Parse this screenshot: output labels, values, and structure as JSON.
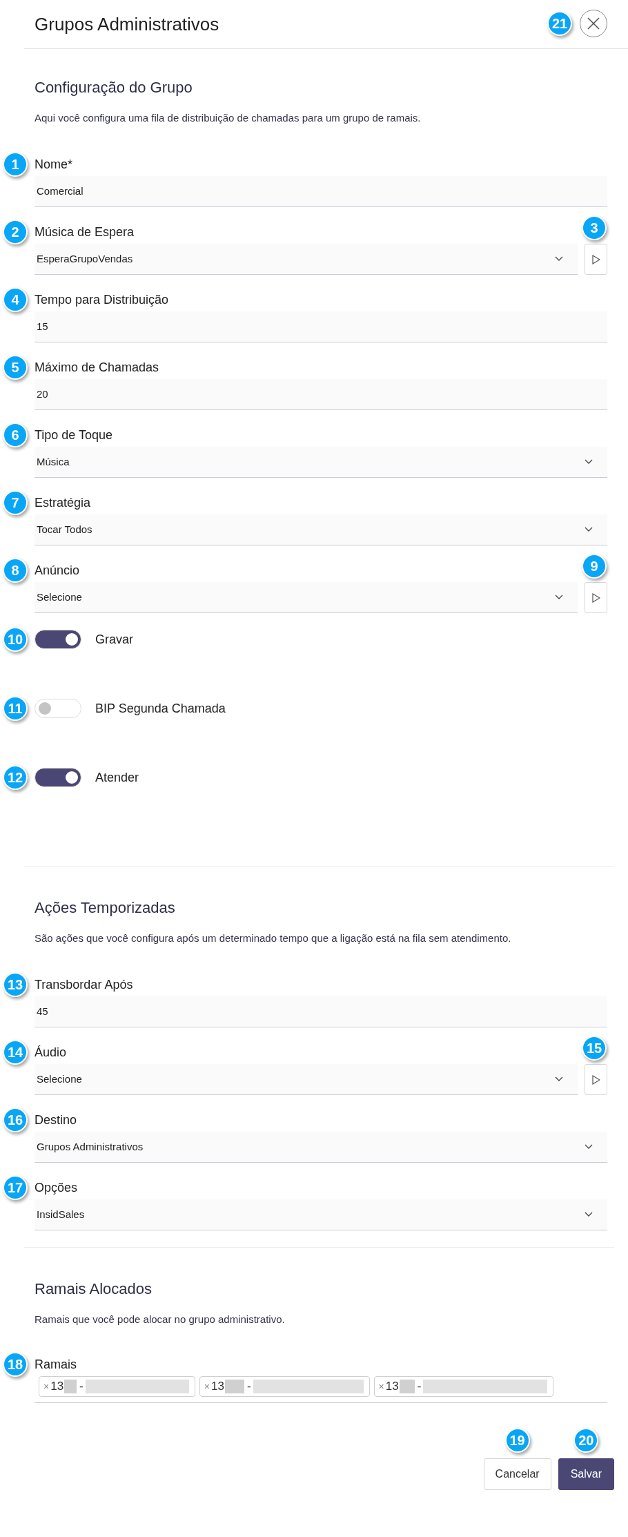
{
  "header": {
    "title": "Grupos Administrativos",
    "close_badge": "21"
  },
  "sections": [
    {
      "title": "Configuração do Grupo",
      "description": "Aqui você configura uma fila de distribuição de chamadas para um grupo de ramais.",
      "fields": [
        {
          "kind": "input",
          "badge": "1",
          "label": "Nome*",
          "value": "Comercial"
        },
        {
          "kind": "select",
          "badge": "2",
          "label": "Música de Espera",
          "value": "EsperaGrupoVendas",
          "play_badge": "3"
        },
        {
          "kind": "input",
          "badge": "4",
          "label": "Tempo para Distribuição",
          "value": "15"
        },
        {
          "kind": "input",
          "badge": "5",
          "label": "Máximo de Chamadas",
          "value": "20"
        },
        {
          "kind": "select",
          "badge": "6",
          "label": "Tipo de Toque",
          "value": "Música"
        },
        {
          "kind": "select",
          "badge": "7",
          "label": "Estratégia",
          "value": "Tocar Todos"
        },
        {
          "kind": "select",
          "badge": "8",
          "label": "Anúncio",
          "value": "Selecione",
          "play_badge": "9"
        },
        {
          "kind": "toggle",
          "badge": "10",
          "label": "Gravar",
          "on": true
        },
        {
          "kind": "toggle",
          "badge": "11",
          "label": "BIP Segunda Chamada",
          "on": false
        },
        {
          "kind": "toggle",
          "badge": "12",
          "label": "Atender",
          "on": true
        }
      ]
    },
    {
      "title": "Ações Temporizadas",
      "description": "São ações que você configura após um determinado tempo que a ligação está na fila sem atendimento.",
      "fields": [
        {
          "kind": "input",
          "badge": "13",
          "label": "Transbordar Após",
          "value": "45"
        },
        {
          "kind": "select",
          "badge": "14",
          "label": "Áudio",
          "value": "Selecione",
          "play_badge": "15"
        },
        {
          "kind": "select",
          "badge": "16",
          "label": "Destino",
          "value": "Grupos Administrativos"
        },
        {
          "kind": "select",
          "badge": "17",
          "label": "Opções",
          "value": "InsidSales"
        }
      ]
    },
    {
      "title": "Ramais Alocados",
      "description": "Ramais que você pode alocar no grupo administrativo.",
      "fields": [
        {
          "kind": "tags",
          "badge": "18",
          "label": "Ramais",
          "tags": [
            {
              "remove": "×",
              "prefix": "13",
              "separator": "-",
              "redacted": true
            },
            {
              "remove": "×",
              "prefix": "13",
              "separator": "-",
              "redacted": true
            },
            {
              "remove": "×",
              "prefix": "13",
              "separator": "-",
              "redacted": true
            }
          ]
        }
      ]
    }
  ],
  "buttons": [
    {
      "kind": "secondary",
      "label": "Cancelar",
      "badge": "19"
    },
    {
      "kind": "primary",
      "label": "Salvar",
      "badge": "20"
    }
  ]
}
